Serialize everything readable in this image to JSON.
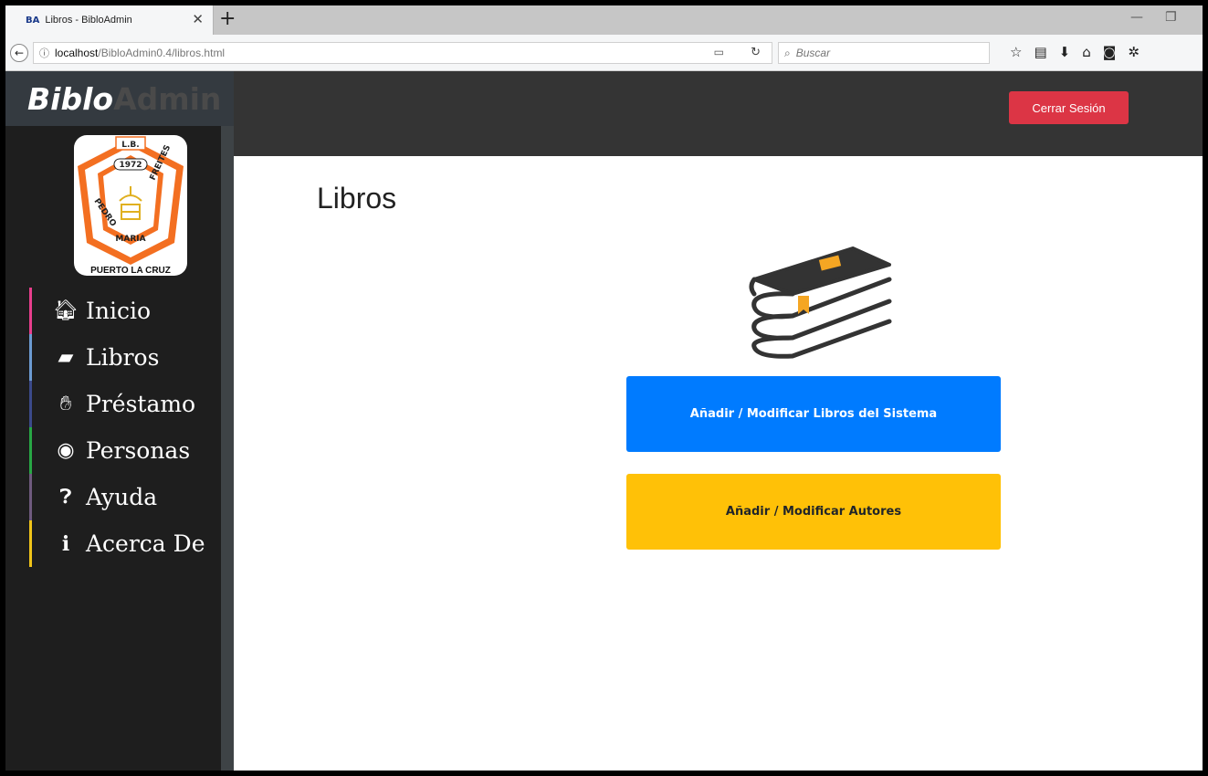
{
  "browser": {
    "tab_favicon": "BA",
    "tab_title": "Libros - BibloAdmin",
    "url_host": "localhost",
    "url_path": "/BibloAdmin0.4/libros.html",
    "search_placeholder": "Buscar"
  },
  "header": {
    "brand_primary": "Biblo",
    "brand_secondary": "Admin",
    "logout_label": "Cerrar Sesión",
    "logout_color": "#dc3545"
  },
  "sidebar": {
    "seal": {
      "top_text": "L.B.",
      "year": "1972",
      "left_text": "PEDRO",
      "bottom_text": "MARIA",
      "right_text": "FREITES",
      "footer_text": "PUERTO LA CRUZ"
    },
    "items": [
      {
        "label": "Inicio",
        "icon": "home-icon",
        "accent": "#e83e8c"
      },
      {
        "label": "Libros",
        "icon": "book-icon",
        "accent": "#6c9bd2"
      },
      {
        "label": "Préstamo",
        "icon": "handshake-icon",
        "accent": "#3b4a8a"
      },
      {
        "label": "Personas",
        "icon": "user-circle-icon",
        "accent": "#28a745"
      },
      {
        "label": "Ayuda",
        "icon": "question-circle-icon",
        "accent": "#6f5a7e"
      },
      {
        "label": "Acerca De",
        "icon": "info-icon",
        "accent": "#f0c419"
      }
    ]
  },
  "main": {
    "title": "Libros",
    "illustration": "stacked-books-icon",
    "buttons": [
      {
        "label": "Añadir / Modificar Libros del Sistema",
        "color": "#007bff"
      },
      {
        "label": "Añadir / Modificar Autores",
        "color": "#ffc107"
      }
    ]
  }
}
